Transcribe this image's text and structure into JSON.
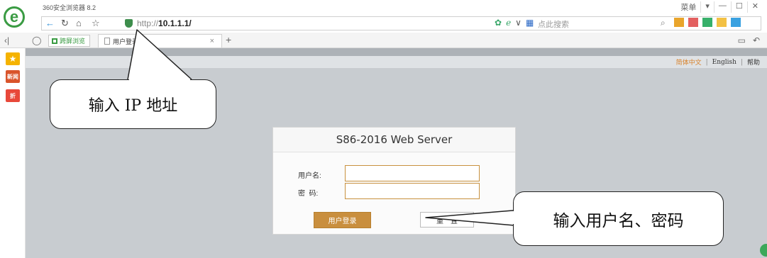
{
  "browser": {
    "window_title": "360安全浏览器 8.2",
    "url_prefix": "http://",
    "url_host": "10.1.1.1/",
    "search_placeholder": "点此搜索",
    "controls": [
      "菜单",
      "▾",
      "—",
      "☐",
      "✕"
    ]
  },
  "tabs": {
    "tab1_label": "跨屏浏览",
    "tab2_label": "用户登录"
  },
  "sidebar": {
    "items": [
      {
        "icon": "star-icon",
        "color": "#f5b300"
      },
      {
        "icon": "news-icon",
        "label": "新闻",
        "color": "#d9542b"
      },
      {
        "icon": "discount-icon",
        "label": "折",
        "color": "#e8483a"
      }
    ]
  },
  "page": {
    "lang": {
      "chinese": "简体中文",
      "english": "English",
      "help": "帮助"
    },
    "login": {
      "title": "S86-2016 Web Server",
      "username_label": "用户名:",
      "password_label": "密  码:",
      "username_value": "",
      "password_value": "",
      "login_button": "用户登录",
      "reset_button": "重置"
    },
    "accent_color": "#c98f3e"
  },
  "annotations": {
    "ip_note": "输入 IP 地址",
    "user_note": "输入用户名、密码"
  }
}
